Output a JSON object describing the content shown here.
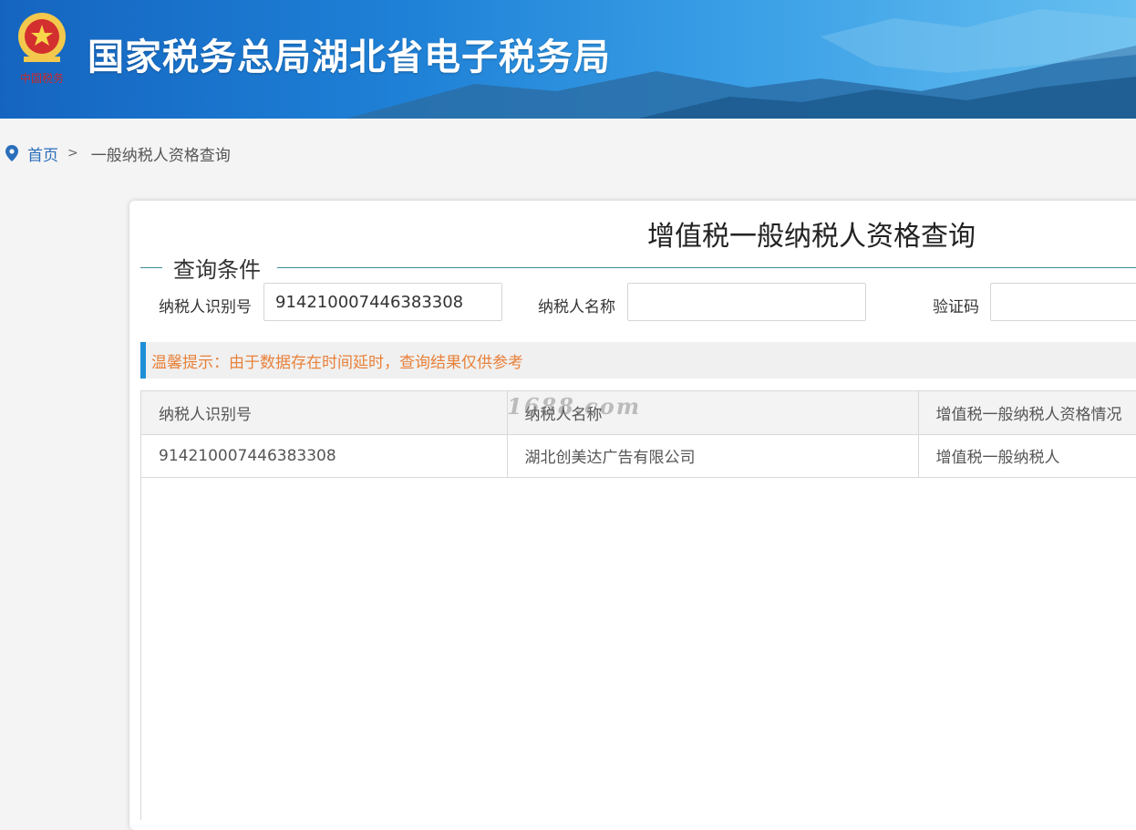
{
  "header": {
    "title": "国家税务总局湖北省电子税务局",
    "emblem_text": "中国税务"
  },
  "breadcrumb": {
    "home": "首页",
    "separator": ">",
    "current": "一般纳税人资格查询"
  },
  "panel": {
    "title": "增值税一般纳税人资格查询",
    "legend": "查询条件",
    "fields": {
      "taxpayer_id": {
        "label": "纳税人识别号",
        "value": "914210007446383308"
      },
      "taxpayer_name": {
        "label": "纳税人名称",
        "value": ""
      },
      "captcha": {
        "label": "验证码",
        "value": ""
      }
    },
    "notice": "温馨提示：由于数据存在时间延时，查询结果仅供参考",
    "table": {
      "headers": [
        "纳税人识别号",
        "纳税人名称",
        "增值税一般纳税人资格情况"
      ],
      "rows": [
        [
          "914210007446383308",
          "湖北创美达广告有限公司",
          "增值税一般纳税人"
        ]
      ]
    }
  },
  "watermark": "1688.com",
  "colors": {
    "banner_blue": "#1e80d6",
    "link_blue": "#2a6ebb",
    "notice_orange": "#e8813a",
    "notice_bar": "#1f8fd6",
    "legend_line": "#3a8f8f"
  }
}
